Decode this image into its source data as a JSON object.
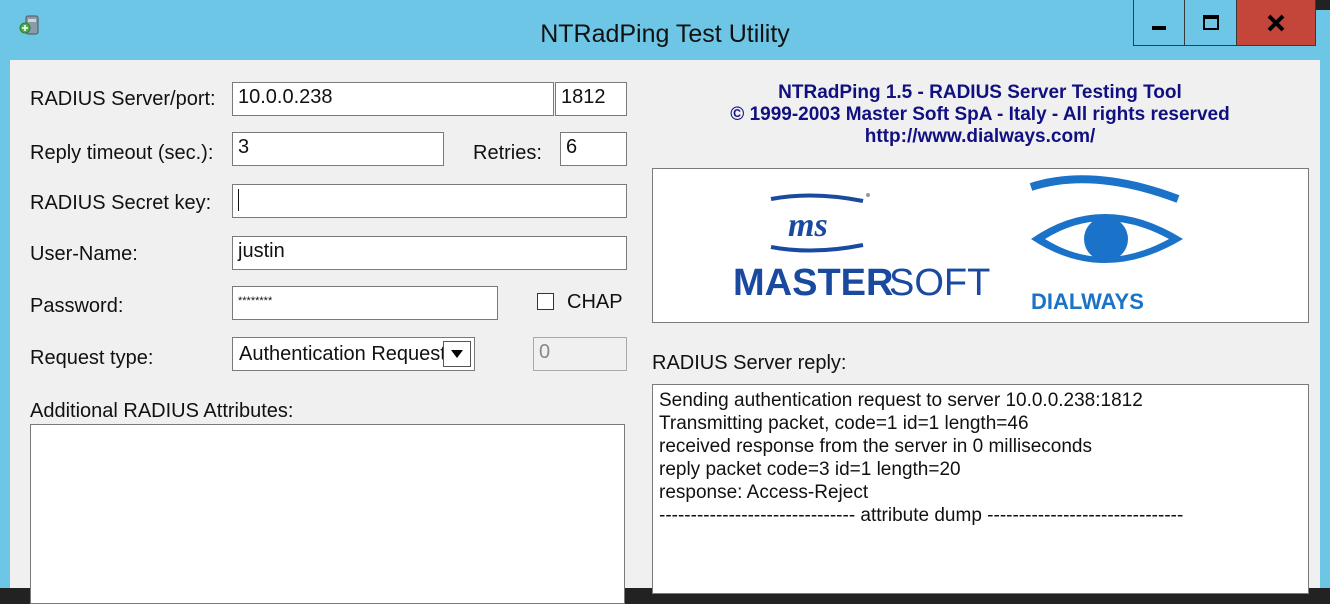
{
  "window": {
    "title": "NTRadPing Test Utility",
    "minimize_glyph": "▁",
    "maximize_glyph": "□",
    "close_glyph": "X"
  },
  "form": {
    "server_label": "RADIUS Server/port:",
    "server_value": "10.0.0.238",
    "port_value": "1812",
    "timeout_label": "Reply timeout (sec.):",
    "timeout_value": "3",
    "retries_label": "Retries:",
    "retries_value": "6",
    "secret_label": "RADIUS Secret key:",
    "secret_value": "",
    "username_label": "User-Name:",
    "username_value": "justin",
    "password_label": "Password:",
    "password_value": "********",
    "chap_label": "CHAP",
    "request_type_label": "Request type:",
    "request_type_value": "Authentication Request",
    "request_code_value": "0",
    "attributes_label": "Additional RADIUS Attributes:"
  },
  "header": {
    "line1": "NTRadPing 1.5 - RADIUS Server Testing Tool",
    "line2": "© 1999-2003 Master Soft SpA - Italy - All rights reserved",
    "line3": "http://www.dialways.com/"
  },
  "logos": {
    "ms_text": "ms",
    "mastersoft_bold": "MASTER",
    "mastersoft_light": "SOFT",
    "dialways_text": "DIALWAYS"
  },
  "reply": {
    "label": "RADIUS Server reply:",
    "lines": [
      "Sending authentication request to server 10.0.0.238:1812",
      "Transmitting packet, code=1 id=1 length=46",
      "received response from the server in 0 milliseconds",
      "reply packet code=3 id=1 length=20",
      "response: Access-Reject",
      "------------------------------- attribute dump -------------------------------"
    ]
  },
  "colors": {
    "titlebar": "#6ec6e6",
    "close_button": "#c4463a",
    "header_text": "#101080",
    "mastersoft_blue": "#1a4aa0",
    "dialways_blue": "#1a73c8"
  }
}
